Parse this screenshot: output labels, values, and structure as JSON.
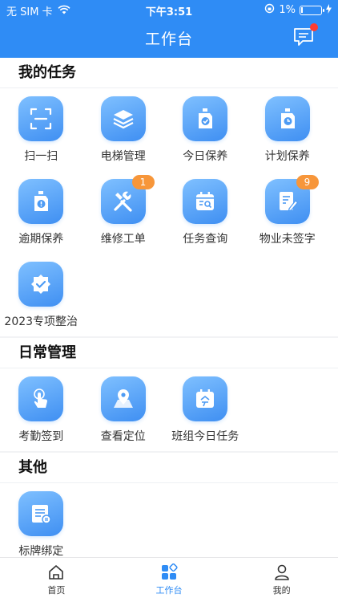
{
  "status_bar": {
    "carrier": "无 SIM 卡",
    "time": "下午3:51",
    "battery": "1%"
  },
  "header": {
    "title": "工作台"
  },
  "sections": [
    {
      "title": "我的任务",
      "items": [
        {
          "label": "扫一扫",
          "icon": "scan-icon",
          "badge": ""
        },
        {
          "label": "电梯管理",
          "icon": "layers-icon",
          "badge": ""
        },
        {
          "label": "今日保养",
          "icon": "oil-bottle-check-icon",
          "badge": ""
        },
        {
          "label": "计划保养",
          "icon": "oil-bottle-clock-icon",
          "badge": ""
        },
        {
          "label": "逾期保养",
          "icon": "oil-bottle-alert-icon",
          "badge": ""
        },
        {
          "label": "维修工单",
          "icon": "wrench-hammer-icon",
          "badge": "1"
        },
        {
          "label": "任务查询",
          "icon": "calendar-search-icon",
          "badge": ""
        },
        {
          "label": "物业未签字",
          "icon": "sign-document-icon",
          "badge": "9"
        },
        {
          "label": "2023专项整治",
          "icon": "shield-check-icon",
          "badge": ""
        }
      ]
    },
    {
      "title": "日常管理",
      "items": [
        {
          "label": "考勤签到",
          "icon": "tap-finger-icon",
          "badge": ""
        },
        {
          "label": "查看定位",
          "icon": "map-pin-icon",
          "badge": ""
        },
        {
          "label": "班组今日任务",
          "icon": "calendar-today-icon",
          "badge": ""
        }
      ]
    },
    {
      "title": "其他",
      "items": [
        {
          "label": "标牌绑定",
          "icon": "tag-card-icon",
          "badge": ""
        }
      ]
    }
  ],
  "tabbar": {
    "home": "首页",
    "workbench": "工作台",
    "mine": "我的"
  },
  "colors": {
    "primary": "#2f8cf5",
    "badge": "#f7963a",
    "notification_dot": "#ff3b30"
  }
}
